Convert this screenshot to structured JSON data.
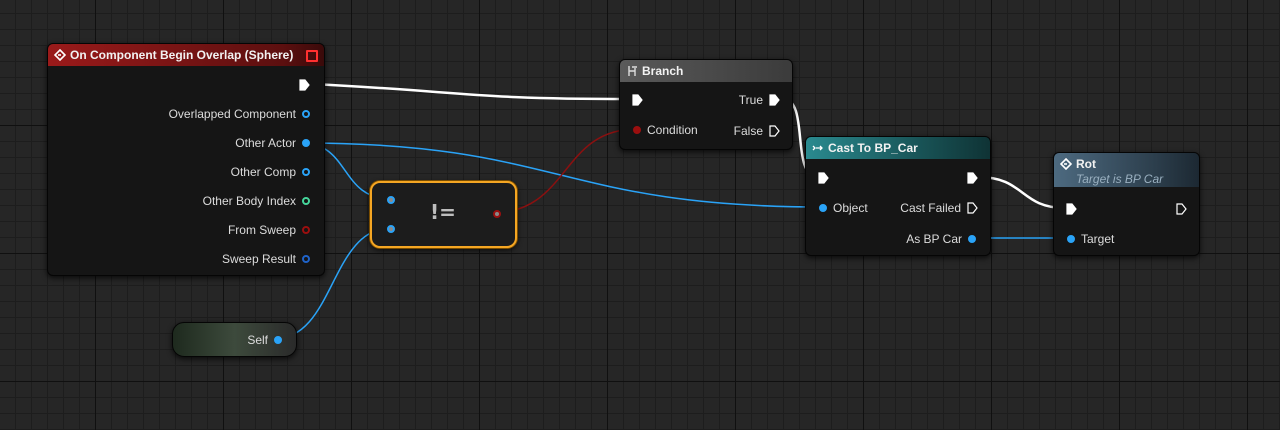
{
  "overlap_node": {
    "title": "On Component Begin Overlap (Sphere)",
    "header_color": "#8a1818",
    "pins": [
      {
        "label": "Overlapped Component"
      },
      {
        "label": "Other Actor"
      },
      {
        "label": "Other Comp"
      },
      {
        "label": "Other Body Index"
      },
      {
        "label": "From Sweep"
      },
      {
        "label": "Sweep Result"
      }
    ]
  },
  "branch_node": {
    "title": "Branch",
    "true_label": "True",
    "false_label": "False",
    "condition_label": "Condition"
  },
  "not_equal_node": {
    "symbol": "!="
  },
  "self_node": {
    "label": "Self"
  },
  "cast_node": {
    "title": "Cast To BP_Car",
    "header_color": "#1f6e73",
    "object_label": "Object",
    "cast_failed_label": "Cast Failed",
    "as_label": "As BP Car"
  },
  "rot_node": {
    "title": "Rot",
    "subtitle": "Target is BP Car",
    "header_color": "#40586a",
    "target_label": "Target"
  },
  "colors": {
    "object_pin": "#2aa3f7",
    "bool_pin": "#9b0f0f",
    "int_pin": "#45d59b",
    "exec_wire": "#ffffff",
    "selection": "#f5a623"
  }
}
